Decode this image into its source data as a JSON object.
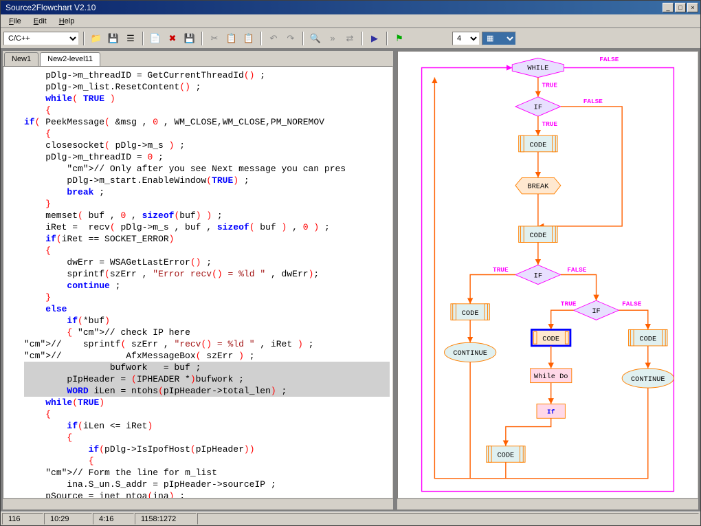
{
  "window": {
    "title": "Source2Flowchart V2.10"
  },
  "menu": {
    "file": "File",
    "edit": "Edit",
    "help": "Help"
  },
  "toolbar": {
    "lang_combo": "C/C++",
    "zoom_value": "4"
  },
  "tabs": {
    "tab1": "New1",
    "tab2": "New2-level11"
  },
  "code_lines": [
    "    pDlg->m_threadID = GetCurrentThreadId() ;",
    "    pDlg->m_list.ResetContent() ;",
    "    while( TRUE )",
    "    {",
    "if( PeekMessage( &msg , 0 , WM_CLOSE,WM_CLOSE,PM_NOREMOV",
    "    {",
    "    closesocket( pDlg->m_s ) ;",
    "    pDlg->m_threadID = 0 ;",
    "        // Only after you see Next message you can pres",
    "        pDlg->m_start.EnableWindow(TRUE) ;",
    "        break ;",
    "    }",
    "    memset( buf , 0 , sizeof(buf) ) ;",
    "    iRet =  recv( pDlg->m_s , buf , sizeof( buf ) , 0 ) ;",
    "    if(iRet == SOCKET_ERROR)",
    "    {",
    "        dwErr = WSAGetLastError() ;",
    "        sprintf(szErr , \"Error recv() = %ld \" , dwErr);",
    "        continue ;",
    "    }",
    "    else",
    "        if(*buf)",
    "        { // check IP here",
    "//    sprintf( szErr , \"recv() = %ld \" , iRet ) ;",
    "//            AfxMessageBox( szErr ) ;",
    "                bufwork   = buf ;",
    "        pIpHeader = (IPHEADER *)bufwork ;",
    "        WORD iLen = ntohs(pIpHeader->total_len) ;",
    "    while(TRUE)",
    "    {",
    "        if(iLen <= iRet)",
    "        {",
    "            if(pDlg->IsIpofHost(pIpHeader))",
    "            {",
    "    // Form the line for m_list",
    "        ina.S_un.S_addr = pIpHeader->sourceIP ;",
    "    pSource = inet_ntoa(ina) ;"
  ],
  "flowchart": {
    "while": "WHILE",
    "if": "IF",
    "code": "CODE",
    "break": "BREAK",
    "continue": "CONTINUE",
    "whiledo": "While Do",
    "iflabel": "If",
    "true": "TRUE",
    "false": "FALSE"
  },
  "status": {
    "c1": "116",
    "c2": "10:29",
    "c3": "4:16",
    "c4": "1158:1272"
  }
}
